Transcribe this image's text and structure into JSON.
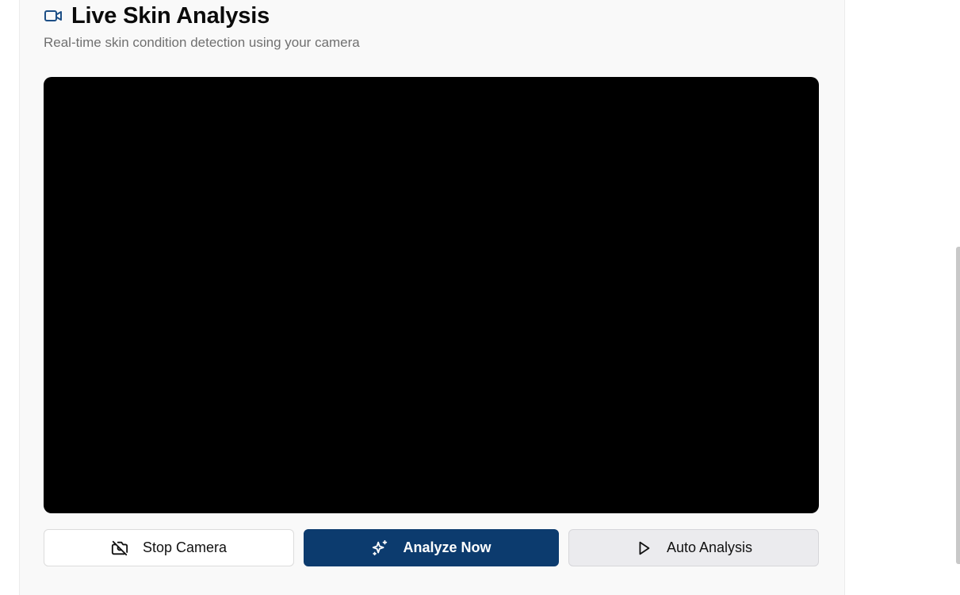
{
  "header": {
    "title": "Live Skin Analysis",
    "subtitle": "Real-time skin condition detection using your camera",
    "icon": "video-camera-icon"
  },
  "video_feed": {
    "background": "#000000"
  },
  "controls": {
    "stop_camera_label": "Stop Camera",
    "stop_camera_icon": "camera-off-icon",
    "analyze_now_label": "Analyze Now",
    "analyze_now_icon": "sparkles-icon",
    "auto_analysis_label": "Auto Analysis",
    "auto_analysis_icon": "play-icon"
  },
  "colors": {
    "accent": "#1d4f86",
    "primary_button": "#0c3b6e",
    "card_background": "#f9f9f9"
  }
}
